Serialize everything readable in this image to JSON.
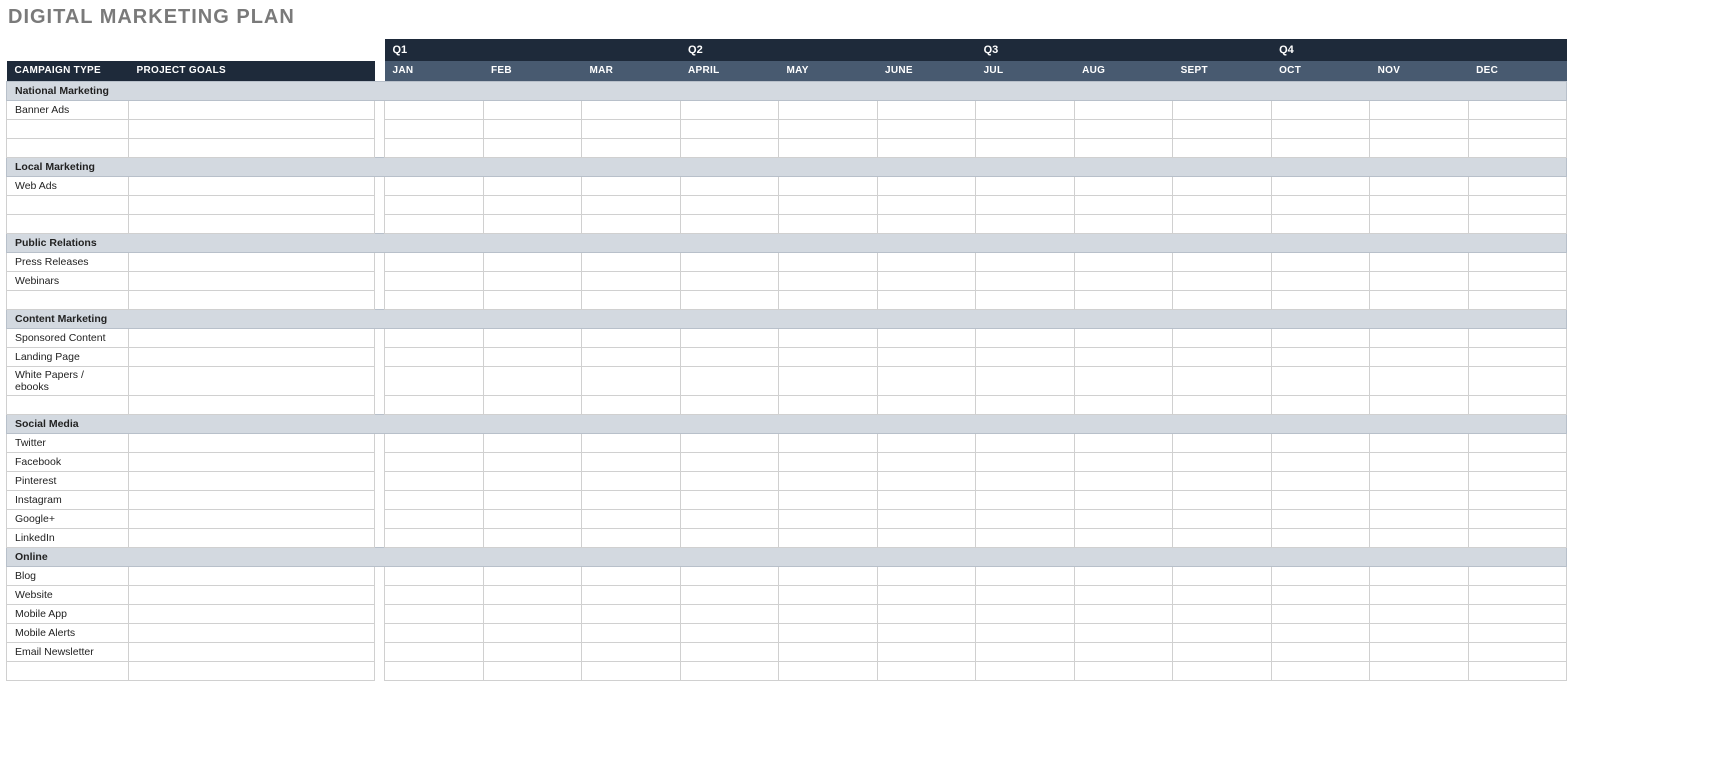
{
  "title": "DIGITAL MARKETING PLAN",
  "columns": {
    "campaign_type": "CAMPAIGN TYPE",
    "project_goals": "PROJECT GOALS"
  },
  "quarters": [
    "Q1",
    "Q2",
    "Q3",
    "Q4"
  ],
  "months": [
    "JAN",
    "FEB",
    "MAR",
    "APRIL",
    "MAY",
    "JUNE",
    "JUL",
    "AUG",
    "SEPT",
    "OCT",
    "NOV",
    "DEC"
  ],
  "sections": [
    {
      "name": "National Marketing",
      "rows": [
        {
          "campaign_type": "Banner Ads",
          "project_goals": "",
          "months": [
            "",
            "",
            "",
            "",
            "",
            "",
            "",
            "",
            "",
            "",
            "",
            ""
          ]
        },
        {
          "campaign_type": "",
          "project_goals": "",
          "months": [
            "",
            "",
            "",
            "",
            "",
            "",
            "",
            "",
            "",
            "",
            "",
            ""
          ]
        },
        {
          "campaign_type": "",
          "project_goals": "",
          "months": [
            "",
            "",
            "",
            "",
            "",
            "",
            "",
            "",
            "",
            "",
            "",
            ""
          ]
        }
      ]
    },
    {
      "name": "Local Marketing",
      "rows": [
        {
          "campaign_type": "Web Ads",
          "project_goals": "",
          "months": [
            "",
            "",
            "",
            "",
            "",
            "",
            "",
            "",
            "",
            "",
            "",
            ""
          ]
        },
        {
          "campaign_type": "",
          "project_goals": "",
          "months": [
            "",
            "",
            "",
            "",
            "",
            "",
            "",
            "",
            "",
            "",
            "",
            ""
          ]
        },
        {
          "campaign_type": "",
          "project_goals": "",
          "months": [
            "",
            "",
            "",
            "",
            "",
            "",
            "",
            "",
            "",
            "",
            "",
            ""
          ]
        }
      ]
    },
    {
      "name": "Public Relations",
      "rows": [
        {
          "campaign_type": "Press Releases",
          "project_goals": "",
          "months": [
            "",
            "",
            "",
            "",
            "",
            "",
            "",
            "",
            "",
            "",
            "",
            ""
          ]
        },
        {
          "campaign_type": "Webinars",
          "project_goals": "",
          "months": [
            "",
            "",
            "",
            "",
            "",
            "",
            "",
            "",
            "",
            "",
            "",
            ""
          ]
        },
        {
          "campaign_type": "",
          "project_goals": "",
          "months": [
            "",
            "",
            "",
            "",
            "",
            "",
            "",
            "",
            "",
            "",
            "",
            ""
          ]
        }
      ]
    },
    {
      "name": "Content Marketing",
      "rows": [
        {
          "campaign_type": "Sponsored Content",
          "project_goals": "",
          "months": [
            "",
            "",
            "",
            "",
            "",
            "",
            "",
            "",
            "",
            "",
            "",
            ""
          ]
        },
        {
          "campaign_type": "Landing Page",
          "project_goals": "",
          "months": [
            "",
            "",
            "",
            "",
            "",
            "",
            "",
            "",
            "",
            "",
            "",
            ""
          ]
        },
        {
          "campaign_type": "White Papers / ebooks",
          "project_goals": "",
          "months": [
            "",
            "",
            "",
            "",
            "",
            "",
            "",
            "",
            "",
            "",
            "",
            ""
          ]
        },
        {
          "campaign_type": "",
          "project_goals": "",
          "months": [
            "",
            "",
            "",
            "",
            "",
            "",
            "",
            "",
            "",
            "",
            "",
            ""
          ]
        }
      ]
    },
    {
      "name": "Social Media",
      "rows": [
        {
          "campaign_type": "Twitter",
          "project_goals": "",
          "months": [
            "",
            "",
            "",
            "",
            "",
            "",
            "",
            "",
            "",
            "",
            "",
            ""
          ]
        },
        {
          "campaign_type": "Facebook",
          "project_goals": "",
          "months": [
            "",
            "",
            "",
            "",
            "",
            "",
            "",
            "",
            "",
            "",
            "",
            ""
          ]
        },
        {
          "campaign_type": "Pinterest",
          "project_goals": "",
          "months": [
            "",
            "",
            "",
            "",
            "",
            "",
            "",
            "",
            "",
            "",
            "",
            ""
          ]
        },
        {
          "campaign_type": "Instagram",
          "project_goals": "",
          "months": [
            "",
            "",
            "",
            "",
            "",
            "",
            "",
            "",
            "",
            "",
            "",
            ""
          ]
        },
        {
          "campaign_type": "Google+",
          "project_goals": "",
          "months": [
            "",
            "",
            "",
            "",
            "",
            "",
            "",
            "",
            "",
            "",
            "",
            ""
          ]
        },
        {
          "campaign_type": "LinkedIn",
          "project_goals": "",
          "months": [
            "",
            "",
            "",
            "",
            "",
            "",
            "",
            "",
            "",
            "",
            "",
            ""
          ]
        }
      ]
    },
    {
      "name": "Online",
      "rows": [
        {
          "campaign_type": "Blog",
          "project_goals": "",
          "months": [
            "",
            "",
            "",
            "",
            "",
            "",
            "",
            "",
            "",
            "",
            "",
            ""
          ]
        },
        {
          "campaign_type": "Website",
          "project_goals": "",
          "months": [
            "",
            "",
            "",
            "",
            "",
            "",
            "",
            "",
            "",
            "",
            "",
            ""
          ]
        },
        {
          "campaign_type": "Mobile App",
          "project_goals": "",
          "months": [
            "",
            "",
            "",
            "",
            "",
            "",
            "",
            "",
            "",
            "",
            "",
            ""
          ]
        },
        {
          "campaign_type": "Mobile Alerts",
          "project_goals": "",
          "months": [
            "",
            "",
            "",
            "",
            "",
            "",
            "",
            "",
            "",
            "",
            "",
            ""
          ]
        },
        {
          "campaign_type": "Email Newsletter",
          "project_goals": "",
          "months": [
            "",
            "",
            "",
            "",
            "",
            "",
            "",
            "",
            "",
            "",
            "",
            ""
          ]
        },
        {
          "campaign_type": "",
          "project_goals": "",
          "months": [
            "",
            "",
            "",
            "",
            "",
            "",
            "",
            "",
            "",
            "",
            "",
            ""
          ]
        }
      ]
    }
  ]
}
